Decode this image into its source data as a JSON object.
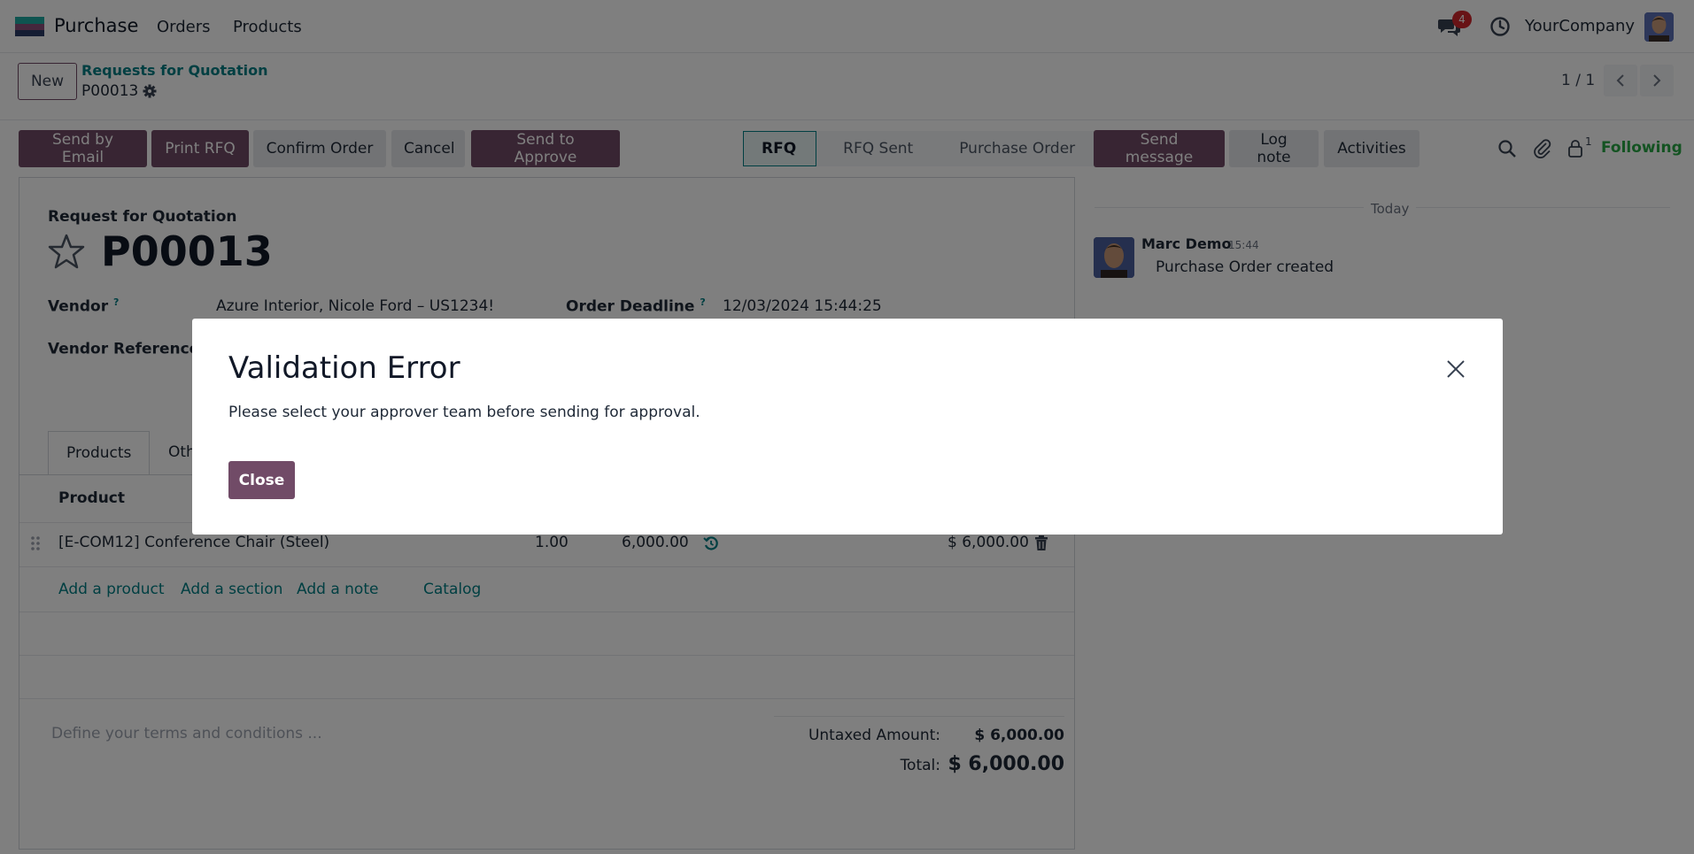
{
  "navbar": {
    "app_name": "Purchase",
    "menu": [
      "Orders",
      "Products"
    ],
    "messages_badge": "4",
    "company": "YourCompany"
  },
  "control_panel": {
    "new_label": "New",
    "breadcrumb_parent": "Requests for Quotation",
    "breadcrumb_current": "P00013",
    "pager": "1 / 1"
  },
  "actions": {
    "send_email": "Send by Email",
    "print_rfq": "Print RFQ",
    "confirm_order": "Confirm Order",
    "cancel": "Cancel",
    "send_to_approve": "Send to Approve"
  },
  "status_stages": [
    {
      "label": "RFQ",
      "active": true
    },
    {
      "label": "RFQ Sent",
      "active": false
    },
    {
      "label": "Purchase Order",
      "active": false
    }
  ],
  "form": {
    "type_label": "Request for Quotation",
    "record_name": "P00013",
    "vendor_label": "Vendor",
    "vendor_value": "Azure Interior, Nicole Ford – US1234!",
    "deadline_label": "Order Deadline",
    "deadline_value": "12/03/2024 15:44:25",
    "vendor_ref_label": "Vendor Reference",
    "help_mark": "?",
    "tabs": [
      "Products",
      "Oth"
    ],
    "column_product": "Product",
    "line": {
      "product": "[E-COM12] Conference Chair (Steel)",
      "qty": "1.00",
      "unit_price": "6,000.00",
      "subtotal": "$ 6,000.00"
    },
    "add_product": "Add a product",
    "add_section": "Add a section",
    "add_note": "Add a note",
    "catalog": "Catalog",
    "terms_placeholder": "Define your terms and conditions ...",
    "untaxed_label": "Untaxed Amount:",
    "untaxed_value": "$ 6,000.00",
    "total_label": "Total:",
    "total_value": "$ 6,000.00"
  },
  "chatter": {
    "send_message": "Send message",
    "log_note": "Log note",
    "activities": "Activities",
    "followers_count": "1",
    "following": "Following",
    "today": "Today",
    "message": {
      "author": "Marc Demo",
      "time": "15:44",
      "body": "Purchase Order created"
    }
  },
  "modal": {
    "title": "Validation Error",
    "body": "Please select your approver team before sending for approval.",
    "close_label": "Close"
  },
  "colors": {
    "brand": "#714b67",
    "link": "#017e84",
    "following": "#28a745",
    "badge": "#d1262c"
  }
}
